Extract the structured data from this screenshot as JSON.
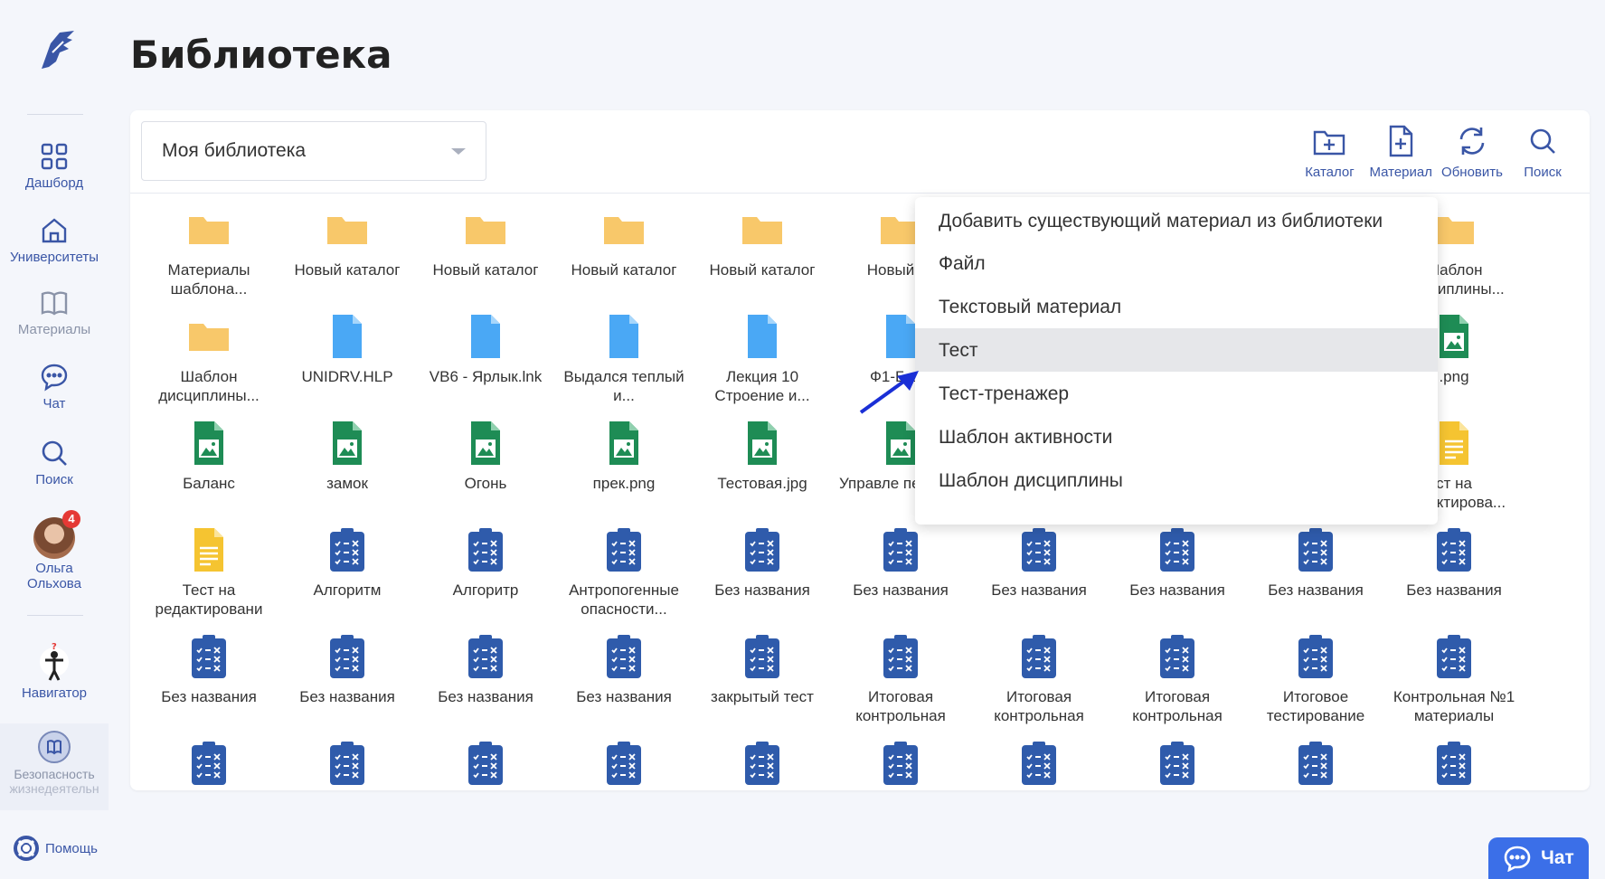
{
  "page": {
    "title": "Библиотека"
  },
  "sidebar": {
    "items": [
      {
        "label": "Дашборд",
        "icon": "grid-icon"
      },
      {
        "label": "Университеты",
        "icon": "home-icon"
      },
      {
        "label": "Материалы",
        "icon": "book-icon"
      },
      {
        "label": "Чат",
        "icon": "chat-bubble-icon"
      },
      {
        "label": "Поиск",
        "icon": "search-icon"
      }
    ],
    "user": {
      "first": "Ольга",
      "last": "Ольхова",
      "badge": "4"
    },
    "navigator": "Навигатор",
    "course": {
      "line1": "Безопасность",
      "line2": "жизнедеятельн"
    },
    "help": "Помощь"
  },
  "toolbar": {
    "library_select": "Моя библиотека",
    "buttons": [
      {
        "label": "Каталог",
        "icon": "folder-plus-icon"
      },
      {
        "label": "Материал",
        "icon": "file-plus-icon"
      },
      {
        "label": "Обновить",
        "icon": "refresh-icon"
      },
      {
        "label": "Поиск",
        "icon": "search-icon"
      }
    ]
  },
  "items": [
    {
      "label": "Материалы шаблона...",
      "type": "folder"
    },
    {
      "label": "Новый каталог",
      "type": "folder"
    },
    {
      "label": "Новый каталог",
      "type": "folder"
    },
    {
      "label": "Новый каталог",
      "type": "folder"
    },
    {
      "label": "Новый каталог",
      "type": "folder"
    },
    {
      "label": "Новый ка",
      "type": "folder"
    },
    {
      "label": "",
      "type": "hidden"
    },
    {
      "label": "",
      "type": "hidden"
    },
    {
      "label": "",
      "type": "hidden"
    },
    {
      "label": "Шаблон дисциплины...",
      "type": "folder"
    },
    {
      "label": "Шаблон дисциплины...",
      "type": "folder"
    },
    {
      "label": "UNIDRV.HLP",
      "type": "file"
    },
    {
      "label": "VB6 - Ярлык.lnk",
      "type": "file"
    },
    {
      "label": "Выдался теплый и...",
      "type": "file"
    },
    {
      "label": "Лекция 10 Строение и...",
      "type": "file"
    },
    {
      "label": "Ф1-Бала",
      "type": "file"
    },
    {
      "label": "",
      "type": "hidden"
    },
    {
      "label": "",
      "type": "hidden"
    },
    {
      "label": "",
      "type": "hidden"
    },
    {
      "label": ".png",
      "type": "image"
    },
    {
      "label": "Баланс",
      "type": "image"
    },
    {
      "label": "замок",
      "type": "image"
    },
    {
      "label": "Огонь",
      "type": "image"
    },
    {
      "label": "прек.png",
      "type": "image"
    },
    {
      "label": "Тестовая.jpg",
      "type": "image"
    },
    {
      "label": "Управле персона",
      "type": "image"
    },
    {
      "label": "",
      "type": "hidden"
    },
    {
      "label": "",
      "type": "hidden"
    },
    {
      "label": "",
      "type": "hidden"
    },
    {
      "label": "ст на редактирова...",
      "type": "doc"
    },
    {
      "label": "Тест на редактировани",
      "type": "doc"
    },
    {
      "label": "Алгоритм",
      "type": "test"
    },
    {
      "label": "Алгоритр",
      "type": "test"
    },
    {
      "label": "Антропогенные опасности...",
      "type": "test"
    },
    {
      "label": "Без названия",
      "type": "test"
    },
    {
      "label": "Без названия",
      "type": "test"
    },
    {
      "label": "Без названия",
      "type": "test"
    },
    {
      "label": "Без названия",
      "type": "test"
    },
    {
      "label": "Без названия",
      "type": "test"
    },
    {
      "label": "Без названия",
      "type": "test"
    },
    {
      "label": "Без названия",
      "type": "test"
    },
    {
      "label": "Без названия",
      "type": "test"
    },
    {
      "label": "Без названия",
      "type": "test"
    },
    {
      "label": "Без названия",
      "type": "test"
    },
    {
      "label": "закрытый тест",
      "type": "test"
    },
    {
      "label": "Итоговая контрольная",
      "type": "test"
    },
    {
      "label": "Итоговая контрольная",
      "type": "test"
    },
    {
      "label": "Итоговая контрольная",
      "type": "test"
    },
    {
      "label": "Итоговое тестирование",
      "type": "test"
    },
    {
      "label": "Контрольная №1 материалы",
      "type": "test"
    }
  ],
  "menu": {
    "items": [
      {
        "label": "Добавить существующий материал из библиотеки",
        "active": false
      },
      {
        "label": "Файл",
        "active": false
      },
      {
        "label": "Текстовый материал",
        "active": false
      },
      {
        "label": "Тест",
        "active": true
      },
      {
        "label": "Тест-тренажер",
        "active": false
      },
      {
        "label": "Шаблон активности",
        "active": false
      },
      {
        "label": "Шаблон дисциплины",
        "active": false
      }
    ]
  },
  "chat_button": "Чат",
  "colors": {
    "accent": "#3a56a6",
    "folder": "#f8c86a",
    "file": "#4aa8f5",
    "image": "#1e8c55",
    "doc": "#f5c431",
    "test": "#2f5bab",
    "menu_active": "#e6e7ea"
  }
}
